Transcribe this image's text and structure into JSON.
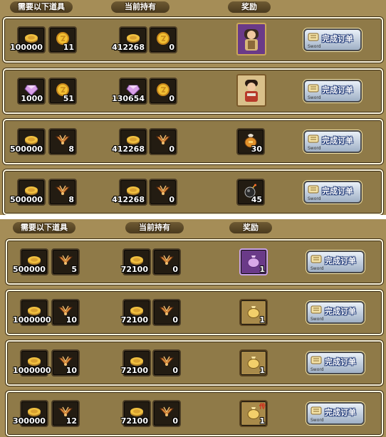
{
  "colors": {
    "panel_bg": "#a58d57",
    "row_bg": "#8f7a48",
    "slot_bg": "#231c12",
    "button_text": "#ffffff"
  },
  "top": {
    "headers": {
      "required": "需要以下道具",
      "current": "当前持有",
      "reward": "奖励"
    },
    "orders": [
      {
        "req1_icon": "gold-coin-icon",
        "req1": "100000",
        "req2_icon": "gold-token-icon",
        "req2": "11",
        "cur1": "412268",
        "cur2": "0",
        "reward_icon": "hero-portrait-icon",
        "reward_count": "",
        "button": "完成订单",
        "button_sub": "Sword"
      },
      {
        "req1_icon": "pink-gem-icon",
        "req1": "1000",
        "req2_icon": "gold-token-icon",
        "req2": "51",
        "cur1": "130654",
        "cur2": "0",
        "reward_icon": "warrior-portrait-icon",
        "reward_count": "",
        "button": "完成订单",
        "button_sub": "Sword"
      },
      {
        "req1_icon": "gold-coin-icon",
        "req1": "500000",
        "req2_icon": "wing-emblem-icon",
        "req2": "8",
        "cur1": "412268",
        "cur2": "0",
        "reward_icon": "potion-pouch-icon",
        "reward_count": "30",
        "button": "完成订单",
        "button_sub": "Sword"
      },
      {
        "req1_icon": "gold-coin-icon",
        "req1": "500000",
        "req2_icon": "wing-emblem-icon",
        "req2": "8",
        "cur1": "412268",
        "cur2": "0",
        "reward_icon": "bomb-icon",
        "reward_count": "45",
        "button": "完成订单",
        "button_sub": "Sword"
      }
    ]
  },
  "bottom": {
    "headers": {
      "required": "需要以下道具",
      "current": "当前持有",
      "reward": "奖励"
    },
    "orders": [
      {
        "req1_icon": "gold-coin-icon",
        "req1": "500000",
        "req2_icon": "wing-emblem-icon",
        "req2": "5",
        "cur1": "72100",
        "cur2": "0",
        "reward_icon": "purple-bag-icon",
        "reward_count": "1",
        "button": "完成订单",
        "button_sub": "Sword"
      },
      {
        "req1_icon": "gold-coin-icon",
        "req1": "1000000",
        "req2_icon": "wing-emblem-icon",
        "req2": "10",
        "cur1": "72100",
        "cur2": "0",
        "reward_icon": "gold-bag-icon",
        "reward_count": "1",
        "button": "完成订单",
        "button_sub": "Sword"
      },
      {
        "req1_icon": "gold-coin-icon",
        "req1": "1000000",
        "req2_icon": "wing-emblem-icon",
        "req2": "10",
        "cur1": "72100",
        "cur2": "0",
        "reward_icon": "gold-bag-icon",
        "reward_count": "1",
        "button": "完成订单",
        "button_sub": "Sword"
      },
      {
        "req1_icon": "gold-coin-icon",
        "req1": "300000",
        "req2_icon": "wing-emblem-icon",
        "req2": "12",
        "cur1": "72100",
        "cur2": "0",
        "reward_icon": "legend-bag-icon",
        "reward_count": "1",
        "reward_tag": "传",
        "button": "完成订单",
        "button_sub": "Sword"
      }
    ]
  }
}
